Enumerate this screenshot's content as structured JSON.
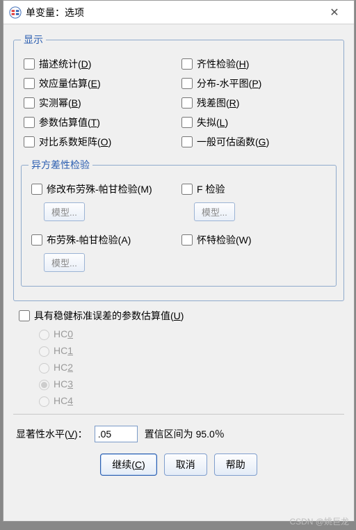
{
  "title": "单变量：选项",
  "displayGroup": {
    "legend": "显示",
    "left": [
      {
        "label": "描述统计(",
        "accel": "D",
        "suffix": ")"
      },
      {
        "label": "效应量估算(",
        "accel": "E",
        "suffix": ")"
      },
      {
        "label": "实测幂(",
        "accel": "B",
        "suffix": ")"
      },
      {
        "label": "参数估算值(",
        "accel": "T",
        "suffix": ")"
      },
      {
        "label": "对比系数矩阵(",
        "accel": "O",
        "suffix": ")"
      }
    ],
    "right": [
      {
        "label": "齐性检验(",
        "accel": "H",
        "suffix": ")"
      },
      {
        "label": "分布-水平图(",
        "accel": "P",
        "suffix": ")"
      },
      {
        "label": "残差图(",
        "accel": "R",
        "suffix": ")"
      },
      {
        "label": "失拟(",
        "accel": "L",
        "suffix": ")"
      },
      {
        "label": "一般可估函数(",
        "accel": "G",
        "suffix": ")"
      }
    ]
  },
  "heteroGroup": {
    "legend": "异方差性检验",
    "items": [
      {
        "label": "修改布劳殊-帕甘检验(M)",
        "model": "模型..."
      },
      {
        "label": "F 检验",
        "model": "模型..."
      },
      {
        "label": "布劳殊-帕甘检验(A)",
        "model": "模型..."
      },
      {
        "label": "怀特检验(W)",
        "model": null
      }
    ]
  },
  "robust": {
    "label": "具有稳健标准误差的参数估算值(",
    "accel": "U",
    "suffix": ")",
    "options": [
      "HC0",
      "HC1",
      "HC2",
      "HC3",
      "HC4"
    ],
    "selected": "HC3"
  },
  "sig": {
    "label": "显著性水平(",
    "accel": "V",
    "suffix": ")：",
    "value": ".05",
    "ciLabel": "置信区间为 95.0％"
  },
  "buttons": {
    "continue": "继续(",
    "continueAccel": "C",
    "continueSuffix": ")",
    "cancel": "取消",
    "help": "帮助"
  },
  "watermark": "CSDN @姚巨龙"
}
